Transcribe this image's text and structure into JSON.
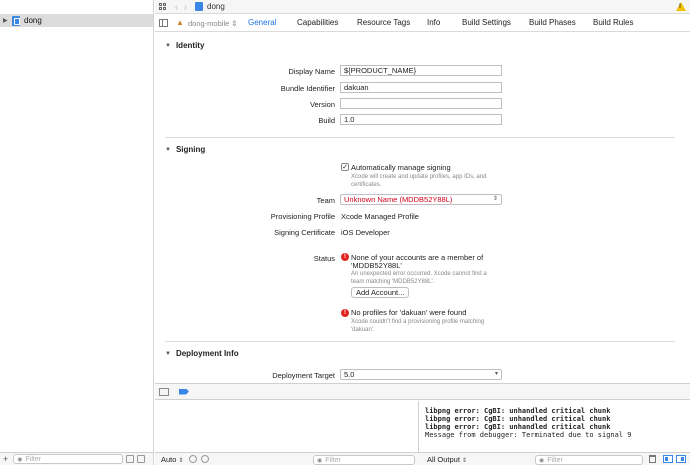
{
  "navigator": {
    "project_name": "dong",
    "filter_placeholder": "Filter"
  },
  "jumpbar": {
    "breadcrumb": "dong"
  },
  "tabs": {
    "target": "dong-mobile",
    "items": [
      "General",
      "Capabilities",
      "Resource Tags",
      "Info",
      "Build Settings",
      "Build Phases",
      "Build Rules"
    ],
    "active": "General"
  },
  "identity": {
    "title": "Identity",
    "display_name_label": "Display Name",
    "display_name_value": "${PRODUCT_NAME}",
    "bundle_id_label": "Bundle Identifier",
    "bundle_id_value": "dakuan",
    "version_label": "Version",
    "version_value": "",
    "build_label": "Build",
    "build_value": "1.0"
  },
  "signing": {
    "title": "Signing",
    "auto_manage_label": "Automatically manage signing",
    "auto_manage_checked": true,
    "auto_manage_help_1": "Xcode will create and update profiles, app IDs, and",
    "auto_manage_help_2": "certificates.",
    "team_label": "Team",
    "team_value": "Unknown Name (MDDB52Y88L)",
    "profile_label": "Provisioning Profile",
    "profile_value": "Xcode Managed Profile",
    "cert_label": "Signing Certificate",
    "cert_value": "iOS Developer",
    "status_label": "Status",
    "error1_title_1": "None of your accounts are a member of",
    "error1_title_2": "'MDDB52Y88L'",
    "error1_detail_1": "An unexpected error occurred. Xcode cannot find a",
    "error1_detail_2": "team matching 'MDDB52Y88L'.",
    "add_account_button": "Add Account...",
    "error2_title": "No profiles for 'dakuan' were found",
    "error2_detail_1": "Xcode couldn't find a provisioning profile matching",
    "error2_detail_2": "'dakuan'."
  },
  "deployment": {
    "title": "Deployment Info",
    "target_label": "Deployment Target",
    "target_value": "5.0"
  },
  "debug": {
    "auto_label": "Auto",
    "filter_placeholder": "Filter",
    "output_label": "All Output",
    "console_lines": [
      "libpng error: CgBI: unhandled critical chunk",
      "libpng error: CgBI: unhandled critical chunk",
      "libpng error: CgBI: unhandled critical chunk",
      "Message from debugger: Terminated due to signal 9"
    ]
  },
  "colors": {
    "accent": "#1a73e8",
    "error": "#d0021b",
    "warning": "#f2c200"
  }
}
